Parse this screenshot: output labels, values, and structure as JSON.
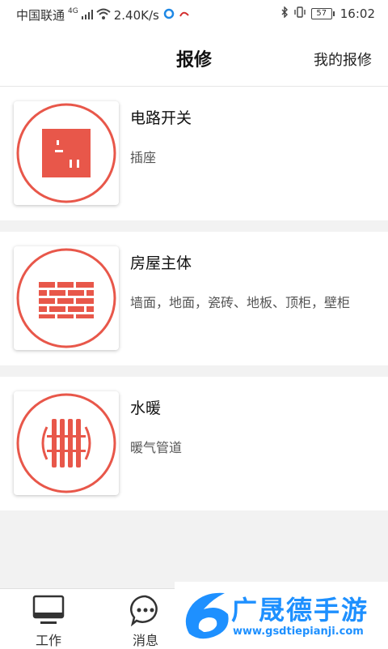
{
  "status_bar": {
    "carrier": "中国联通",
    "network": "4G",
    "speed": "2.40K/s",
    "battery": "57",
    "time": "16:02"
  },
  "nav": {
    "title": "报修",
    "my_repairs": "我的报修"
  },
  "categories": [
    {
      "title": "电路开关",
      "desc": "插座",
      "icon": "power-outlet-icon"
    },
    {
      "title": "房屋主体",
      "desc": "墙面，地面，瓷砖、地板、顶柜，壁柜",
      "icon": "brick-wall-icon"
    },
    {
      "title": "水暖",
      "desc": "暖气管道",
      "icon": "radiator-icon"
    }
  ],
  "tabs": [
    {
      "label": "工作",
      "icon": "monitor-icon"
    },
    {
      "label": "消息",
      "icon": "chat-icon"
    }
  ],
  "watermark": {
    "text": "广晟德手游",
    "url": "www.gsdtiepianji.com"
  },
  "colors": {
    "accent": "#e8574a",
    "watermark": "#1e90ff"
  }
}
